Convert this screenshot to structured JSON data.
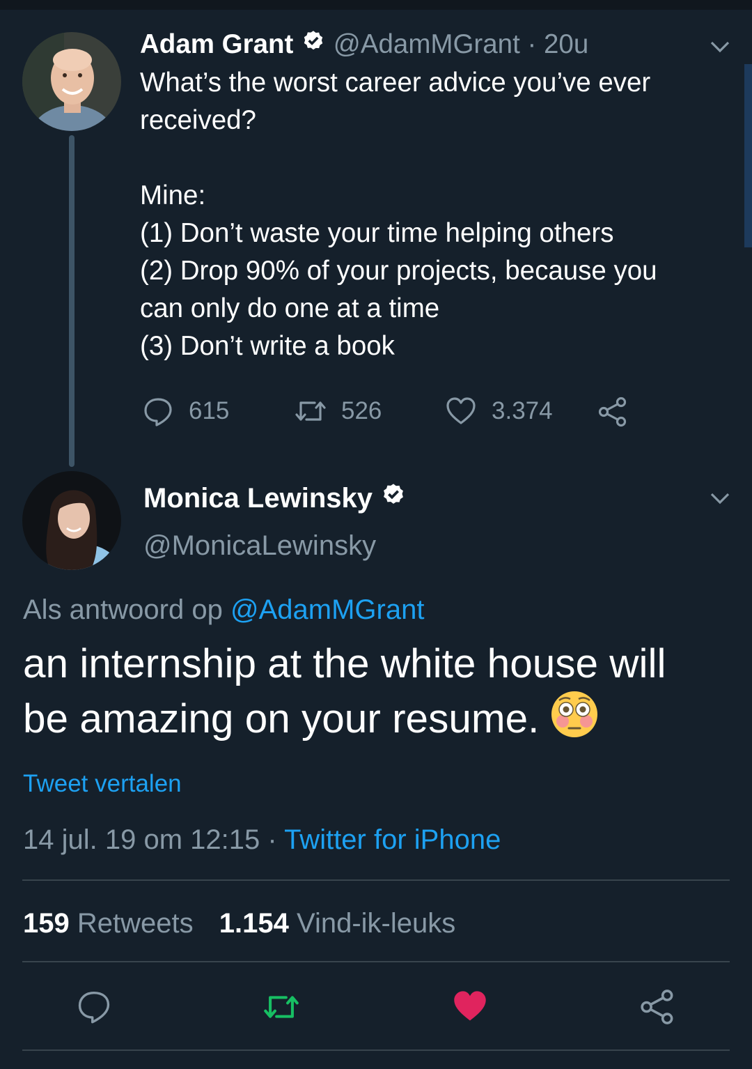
{
  "parent_tweet": {
    "author_name": "Adam Grant",
    "handle": "@AdamMGrant",
    "separator": "·",
    "time": "20u",
    "text_lines": [
      "What’s the worst career advice you’ve ever",
      "received?",
      "",
      "Mine:",
      "(1) Don’t waste your time helping others",
      "(2) Drop 90% of your projects, because you",
      "can only do one at a time",
      "(3) Don’t write a book"
    ],
    "reply_count": "615",
    "retweet_count": "526",
    "like_count": "3.374"
  },
  "main_tweet": {
    "author_name": "Monica Lewinsky",
    "handle": "@MonicaLewinsky",
    "reply_prefix": "Als antwoord op",
    "reply_to": "@AdamMGrant",
    "text_lines": [
      "an internship at the white house will",
      "be amazing on your resume."
    ],
    "translate_link": "Tweet vertalen",
    "timestamp": "14 jul. 19 om 12:15",
    "meta_separator": "·",
    "source": "Twitter for iPhone",
    "retweets_count": "159",
    "retweets_label": "Retweets",
    "likes_count": "1.154",
    "likes_label": "Vind-ik-leuks"
  },
  "icons": {
    "verified": "verified-badge-icon",
    "menu": "chevron-down-icon",
    "reply": "reply-icon",
    "retweet": "retweet-icon",
    "like": "heart-icon",
    "share": "share-icon",
    "emoji": "flushed-face-emoji"
  },
  "colors": {
    "background": "#15202b",
    "accent": "#1da1f2",
    "muted": "#8899a6",
    "retweet_active": "#17bf63",
    "like_active": "#e0245e"
  }
}
